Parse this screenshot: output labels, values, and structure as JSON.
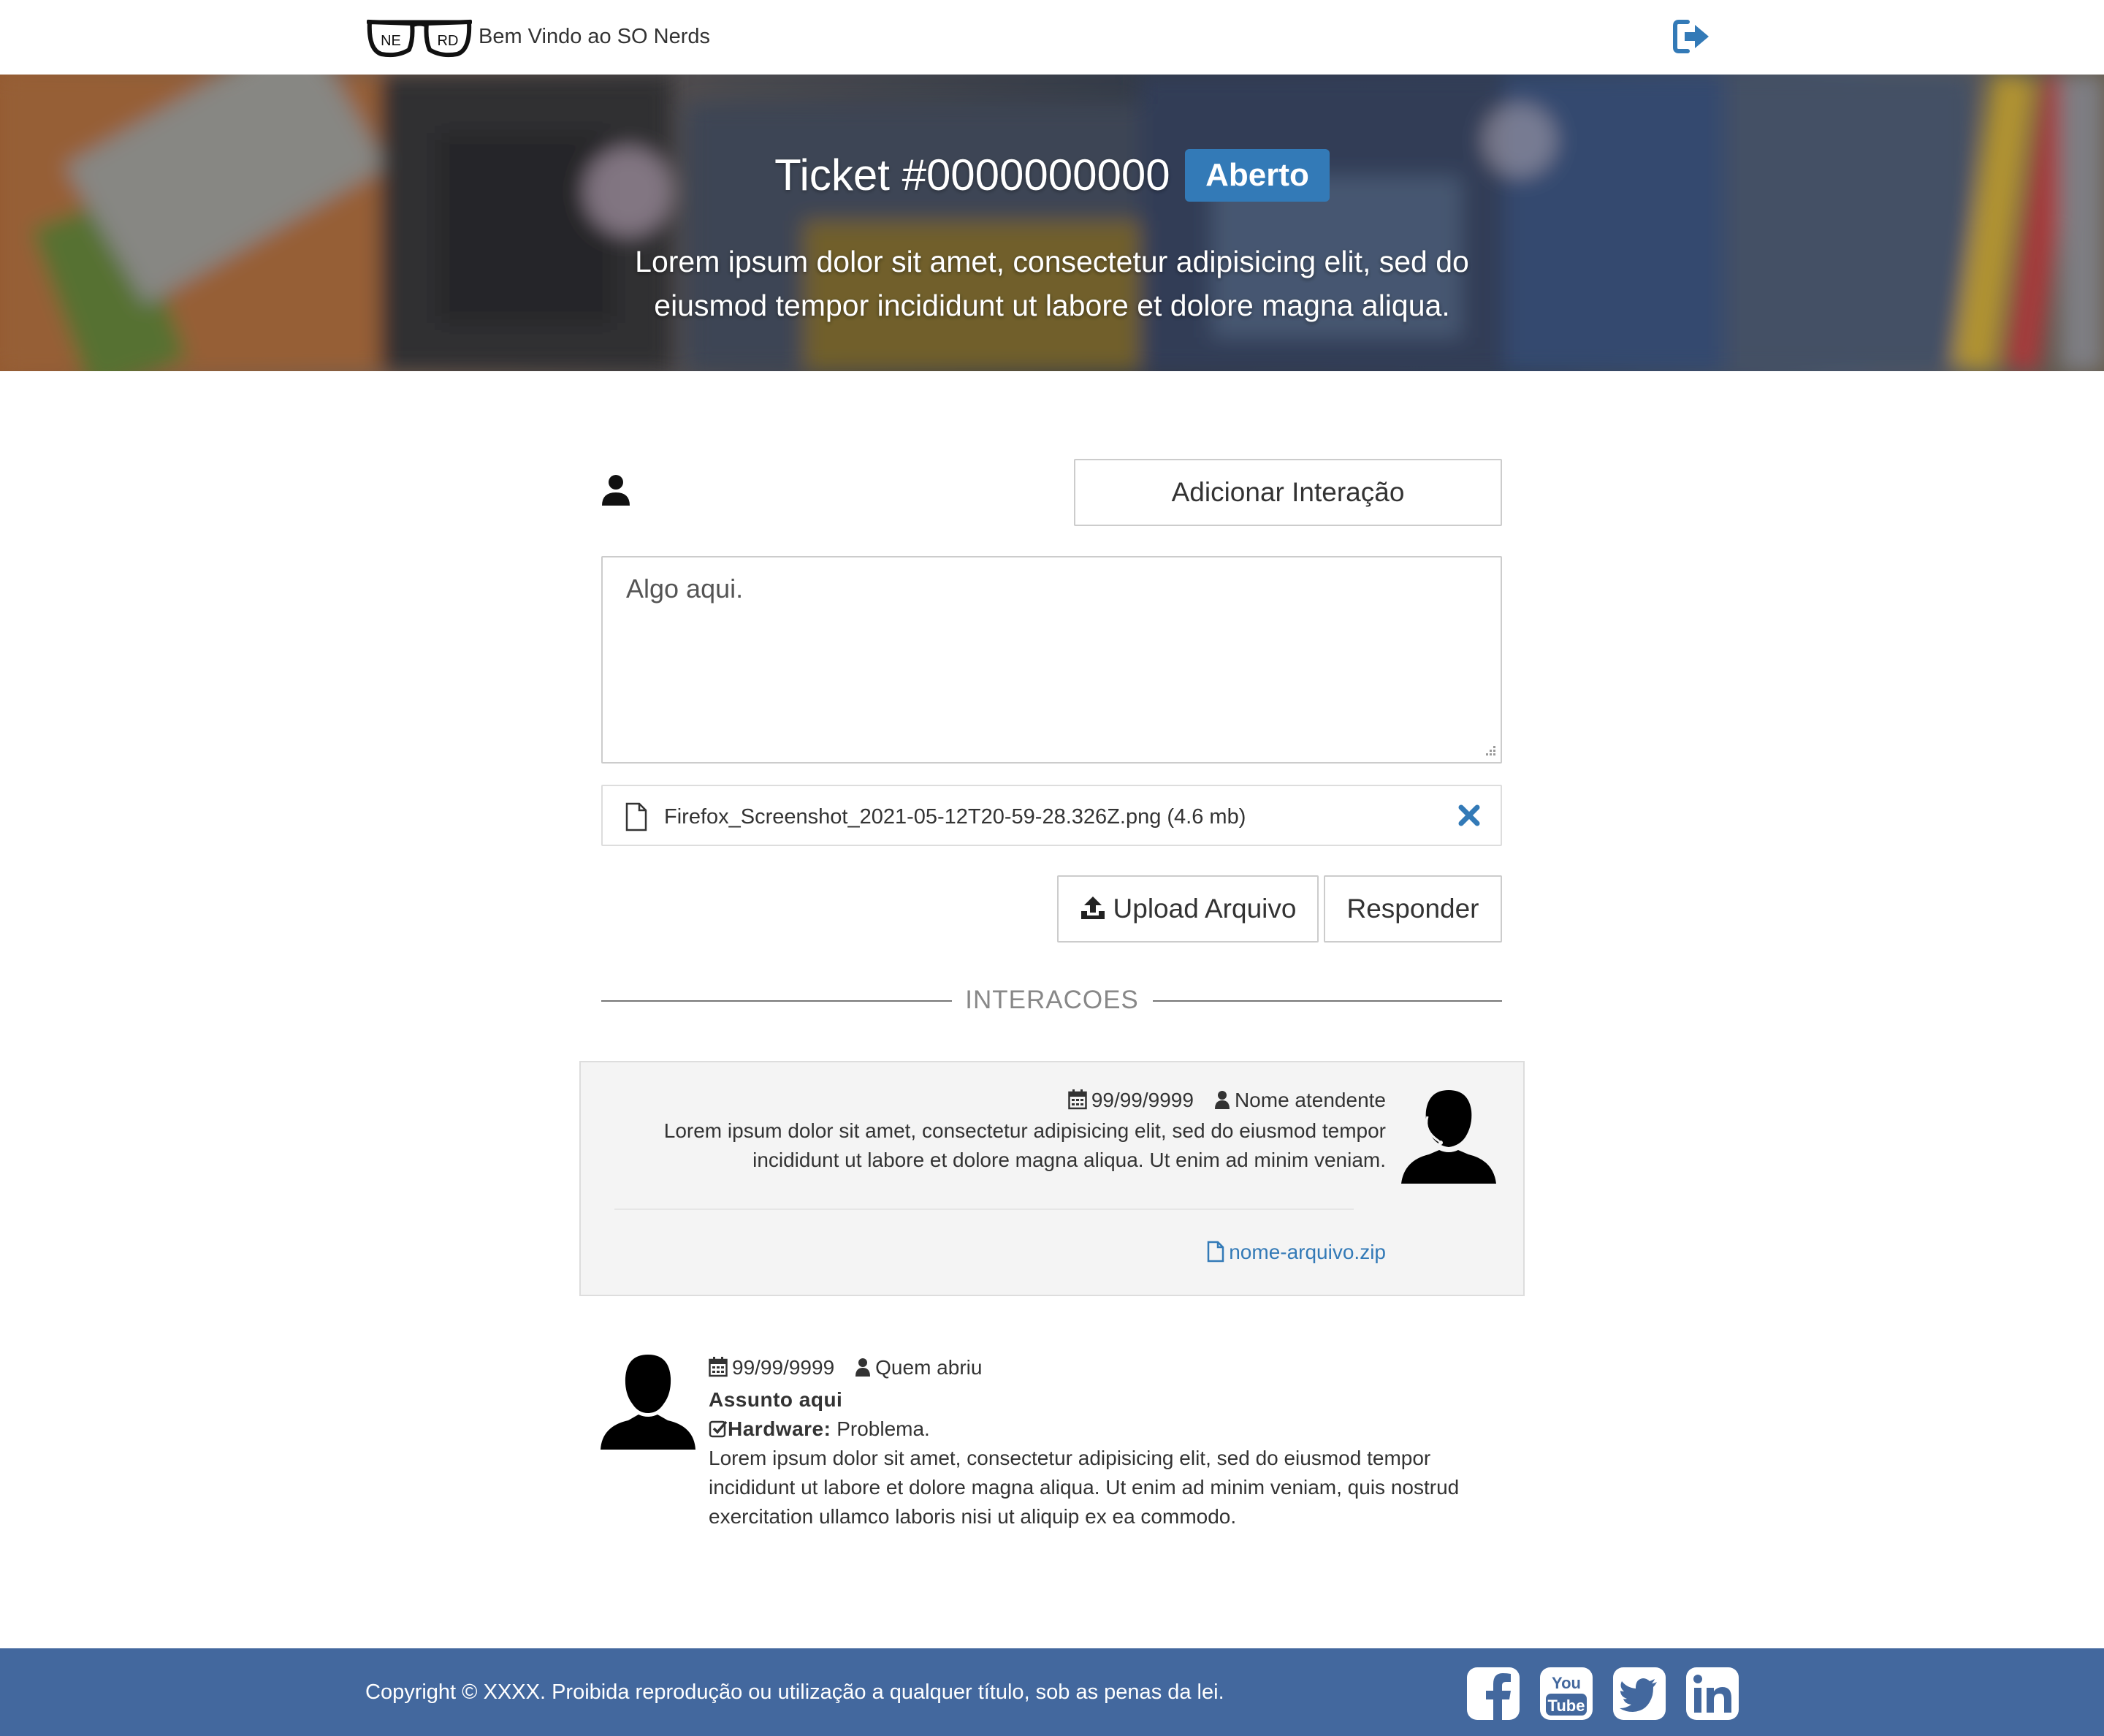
{
  "navbar": {
    "logo_letters": [
      "NE",
      "RD"
    ],
    "welcome_text": "Bem Vindo ao SO Nerds",
    "logout_icon": "sign-out-icon",
    "accent_color": "#337ab7"
  },
  "hero": {
    "title": "Ticket #0000000000",
    "status_badge": "Aberto",
    "subtitle": "Lorem ipsum dolor sit amet, consectetur adipisicing elit, sed do eiusmod tempor incididunt ut labore et dolore magna aliqua."
  },
  "form": {
    "add_interaction_label": "Adicionar Interação",
    "message_value": "Algo aqui.",
    "attachment": {
      "file_name": "Firefox_Screenshot_2021-05-12T20-59-28.326Z.png (4.6 mb)",
      "remove_icon": "close-icon"
    },
    "upload_label": "Upload Arquivo",
    "respond_label": "Responder"
  },
  "interactions": {
    "section_label": "INTERACOES",
    "items": [
      {
        "date": "99/99/9999",
        "author": "Nome atendente",
        "text": "Lorem ipsum dolor sit amet, consectetur adipisicing elit, sed do eiusmod tempor incididunt ut labore et dolore magna aliqua. Ut enim ad minim veniam.",
        "attachment": "nome-arquivo.zip"
      },
      {
        "date": "99/99/9999",
        "author": "Quem abriu",
        "subject": "Assunto aqui",
        "category_label": "Hardware:",
        "category_value": "Problema.",
        "text": "Lorem ipsum dolor sit amet, consectetur adipisicing elit, sed do eiusmod tempor incididunt ut labore et dolore magna aliqua. Ut enim ad minim veniam, quis nostrud exercitation ullamco laboris nisi ut aliquip ex ea commodo."
      }
    ]
  },
  "footer": {
    "copyright": "Copyright © XXXX. Proibida reprodução ou utilização a qualquer título, sob as penas da lei.",
    "background_color": "#43689e",
    "social_icons": [
      "facebook-icon",
      "youtube-icon",
      "twitter-icon",
      "linkedin-icon"
    ],
    "youtube_text": [
      "You",
      "Tube"
    ]
  }
}
